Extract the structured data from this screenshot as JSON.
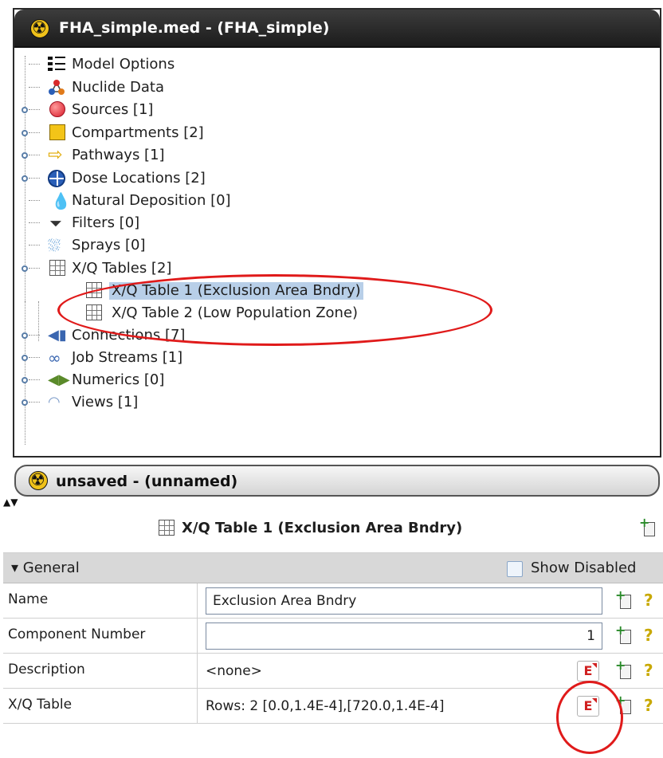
{
  "window1": {
    "title": "FHA_simple.med - (FHA_simple)"
  },
  "tree": {
    "items": [
      {
        "label": "Model Options",
        "icon": "list-options-icon",
        "expandable": false
      },
      {
        "label": "Nuclide Data",
        "icon": "nuclide-molecule-icon",
        "expandable": false
      },
      {
        "label": "Sources [1]",
        "icon": "source-red-circle-icon",
        "expandable": true
      },
      {
        "label": "Compartments [2]",
        "icon": "compartment-yellow-square-icon",
        "expandable": true
      },
      {
        "label": "Pathways [1]",
        "icon": "pathway-arrow-icon",
        "expandable": true
      },
      {
        "label": "Dose Locations [2]",
        "icon": "dose-location-crosshair-icon",
        "expandable": true
      },
      {
        "label": "Natural Deposition [0]",
        "icon": "natural-deposition-drop-icon",
        "expandable": false
      },
      {
        "label": "Filters [0]",
        "icon": "filter-funnel-icon",
        "expandable": false
      },
      {
        "label": "Sprays [0]",
        "icon": "spray-icon",
        "expandable": false
      },
      {
        "label": "X/Q Tables [2]",
        "icon": "table-grid-icon",
        "expandable": true,
        "expanded": true
      },
      {
        "label": "X/Q Table 1 (Exclusion Area Bndry)",
        "icon": "table-grid-icon",
        "child": true,
        "selected": true
      },
      {
        "label": "X/Q Table 2 (Low Population Zone)",
        "icon": "table-grid-icon",
        "child": true
      },
      {
        "label": "Connections [7]",
        "icon": "connection-plug-icon",
        "expandable": true
      },
      {
        "label": "Job Streams [1]",
        "icon": "job-stream-icon",
        "expandable": true
      },
      {
        "label": "Numerics [0]",
        "icon": "numerics-icon",
        "expandable": true
      },
      {
        "label": "Views [1]",
        "icon": "views-eye-icon",
        "expandable": true
      }
    ]
  },
  "window2": {
    "title": "unsaved - (unnamed)"
  },
  "properties": {
    "title": "X/Q Table 1 (Exclusion Area Bndry)",
    "section": "General",
    "show_disabled_label": "Show Disabled",
    "show_disabled_checked": false,
    "rows": [
      {
        "name": "Name",
        "value": "Exclusion Area Bndry",
        "kind": "text"
      },
      {
        "name": "Component Number",
        "value": "1",
        "kind": "number"
      },
      {
        "name": "Description",
        "value": "<none>",
        "kind": "editor"
      },
      {
        "name": "X/Q Table",
        "value": "Rows: 2 [0.0,1.4E-4],[720.0,1.4E-4]",
        "kind": "editor"
      }
    ],
    "editor_button_label": "E"
  },
  "colors": {
    "selection": "#b8cfe8",
    "annotation": "#e01a1a",
    "titlebar": "#1c1c1c"
  }
}
